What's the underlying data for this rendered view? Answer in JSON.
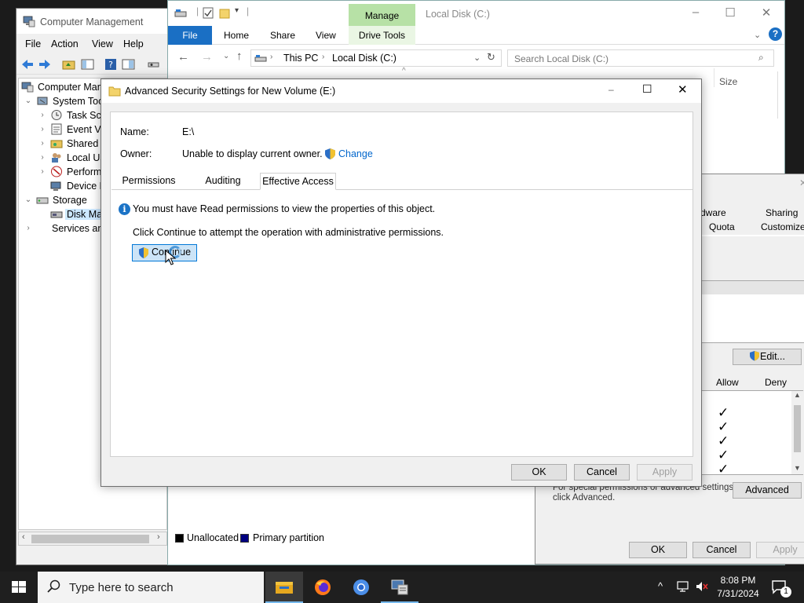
{
  "computer_management": {
    "title": "Computer Management",
    "menu": [
      "File",
      "Action",
      "View",
      "Help"
    ],
    "tree": [
      {
        "label": "Computer Mana",
        "level": 0
      },
      {
        "label": "System Tools",
        "level": 1
      },
      {
        "label": "Task Sche",
        "level": 2
      },
      {
        "label": "Event Vi",
        "level": 2
      },
      {
        "label": "Shared F",
        "level": 2
      },
      {
        "label": "Local Us",
        "level": 2
      },
      {
        "label": "Perform",
        "level": 2
      },
      {
        "label": "Device M",
        "level": 2
      },
      {
        "label": "Storage",
        "level": 1
      },
      {
        "label": "Disk Man",
        "level": 2
      },
      {
        "label": "Services and",
        "level": 1
      }
    ]
  },
  "explorer": {
    "title": "Local Disk (C:)",
    "manage_tab": "Manage",
    "ribbon_tabs": {
      "file": "File",
      "home": "Home",
      "share": "Share",
      "view": "View",
      "drive_tools": "Drive Tools"
    },
    "breadcrumb": [
      "This PC",
      "Local Disk (C:)"
    ],
    "search_placeholder": "Search Local Disk (C:)",
    "column_size": "Size",
    "legend": {
      "unallocated": "Unallocated",
      "primary": "Primary partition"
    },
    "colors": {
      "unallocated": "#000000",
      "primary": "#000080"
    }
  },
  "properties": {
    "tabs_row1": [
      "rdware",
      "Sharing"
    ],
    "tabs_row2": [
      "Quota",
      "Customize"
    ],
    "edit_button": "Edit...",
    "perm_headers": {
      "allow": "Allow",
      "deny": "Deny"
    },
    "special_text_1": "For special permissions or advanced settings,",
    "special_text_2": "click Advanced.",
    "advanced_button": "Advanced",
    "ok": "OK",
    "cancel": "Cancel",
    "apply": "Apply"
  },
  "advanced_security": {
    "title": "Advanced Security Settings for New Volume (E:)",
    "name_label": "Name:",
    "name_value": "E:\\",
    "owner_label": "Owner:",
    "owner_value": "Unable to display current owner.",
    "change_link": "Change",
    "tabs": [
      "Permissions",
      "Auditing",
      "Effective Access"
    ],
    "active_tab": "Effective Access",
    "info_message": "You must have Read permissions to view the properties of this object.",
    "continue_message": "Click Continue to attempt the operation with administrative permissions.",
    "continue_button": "Continue",
    "ok": "OK",
    "cancel": "Cancel",
    "apply": "Apply"
  },
  "taskbar": {
    "search_placeholder": "Type here to search",
    "time": "8:08 PM",
    "date": "7/31/2024",
    "notification_count": "1"
  }
}
